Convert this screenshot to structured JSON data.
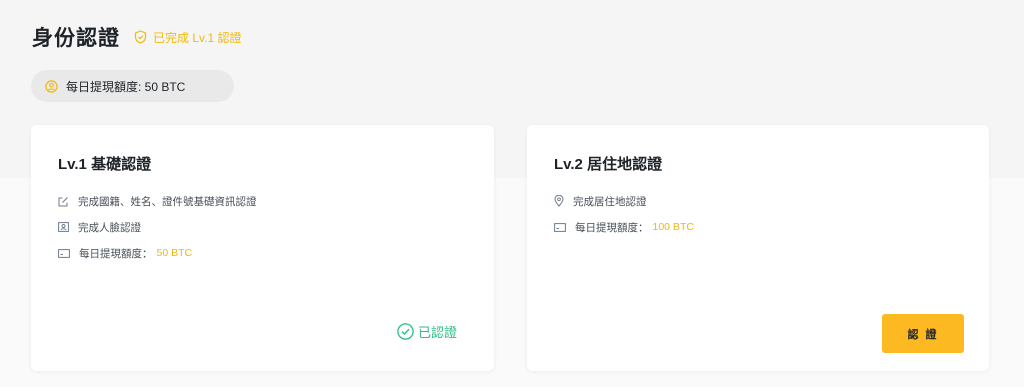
{
  "header": {
    "title": "身份認證",
    "status_text": "已完成 Lv.1 認證"
  },
  "limit_pill": {
    "label": "每日提現額度: 50 BTC"
  },
  "cards": [
    {
      "title": "Lv.1 基礎認證",
      "requirements": [
        {
          "icon": "edit-icon",
          "text": "完成國籍、姓名、證件號基礎資訊認證"
        },
        {
          "icon": "id-card-icon",
          "text": "完成人臉認證"
        },
        {
          "icon": "wallet-icon",
          "text": "每日提現額度：",
          "highlight": "50 BTC"
        }
      ],
      "status": "已認證"
    },
    {
      "title": "Lv.2 居住地認證",
      "requirements": [
        {
          "icon": "location-pin-icon",
          "text": "完成居住地認證"
        },
        {
          "icon": "wallet-icon",
          "text": "每日提現額度：",
          "highlight": "100 BTC"
        }
      ],
      "button_label": "認 證"
    }
  ],
  "colors": {
    "accent": "#f0b90b",
    "button": "#fcb921",
    "success": "#2ebd85",
    "text": "#1e2329"
  }
}
